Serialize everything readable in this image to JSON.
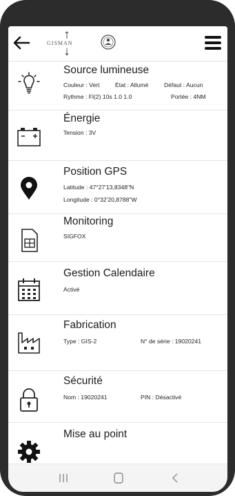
{
  "header": {
    "logo_text": "GISMAN",
    "back_icon": "back-arrow-icon",
    "menu_icon": "hamburger-menu-icon"
  },
  "items": [
    {
      "title": "Source lumineuse",
      "icon": "light-bulb-icon",
      "lines": [
        [
          "Couleur : Vert",
          "État : Allumé",
          "Défaut : Aucun"
        ],
        [
          "Rythme : Fl(2) 10s 1.0 1.0",
          "Portée : 4NM"
        ]
      ]
    },
    {
      "title": "Énergie",
      "icon": "battery-icon",
      "lines": [
        [
          "Tension : 3V"
        ]
      ]
    },
    {
      "title": "Position GPS",
      "icon": "map-pin-icon",
      "lines": [
        [
          "Latitude : 47°27'13,8348\"N"
        ],
        [
          "Longitude : 0°32'20,8788\"W"
        ]
      ]
    },
    {
      "title": "Monitoring",
      "icon": "sim-card-icon",
      "lines": [
        [
          "SIGFOX"
        ]
      ]
    },
    {
      "title": "Gestion Calendaire",
      "icon": "calendar-icon",
      "lines": [
        [
          "Activé"
        ]
      ]
    },
    {
      "title": "Fabrication",
      "icon": "factory-icon",
      "lines": [
        [
          "Type : GIS-2",
          "N° de série : 19020241"
        ]
      ]
    },
    {
      "title": "Sécurité",
      "icon": "padlock-icon",
      "lines": [
        [
          "Nom : 19020241",
          "PIN : Désactivé"
        ]
      ]
    },
    {
      "title": "Mise au point",
      "icon": "gear-icon",
      "lines": []
    }
  ],
  "navbar": {
    "recent_icon": "recent-apps-icon",
    "home_icon": "home-icon",
    "back_icon": "system-back-icon"
  }
}
